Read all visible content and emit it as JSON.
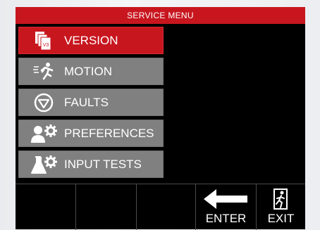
{
  "header": {
    "title": "SERVICE MENU"
  },
  "menu": {
    "items": [
      {
        "label": "VERSION",
        "icon": "version-icon",
        "active": true
      },
      {
        "label": "MOTION",
        "icon": "motion-icon",
        "active": false
      },
      {
        "label": "FAULTS",
        "icon": "faults-icon",
        "active": false
      },
      {
        "label": "PREFERENCES",
        "icon": "preferences-icon",
        "active": false
      },
      {
        "label": "INPUT TESTS",
        "icon": "input-tests-icon",
        "active": false
      }
    ],
    "version_icon_text": "V3"
  },
  "softkeys": {
    "enter": {
      "label": "ENTER",
      "icon": "enter-arrow-icon"
    },
    "exit": {
      "label": "EXIT",
      "icon": "exit-door-icon"
    }
  },
  "colors": {
    "accent_red": "#c8161f",
    "menu_gray": "#808080",
    "screen_bg": "#000000",
    "text": "#ffffff"
  }
}
